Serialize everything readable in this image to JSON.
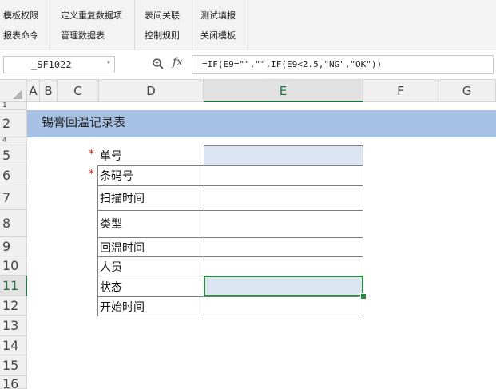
{
  "ribbon": {
    "groups": [
      {
        "top": "模板权限",
        "bottom": "报表命令"
      },
      {
        "top": "定义重复数据项",
        "bottom": "管理数据表"
      },
      {
        "top": "表间关联",
        "bottom": "控制规则"
      },
      {
        "top": "测试填报",
        "bottom": "关闭模板"
      }
    ]
  },
  "formula_bar": {
    "name_box": "_SF1022",
    "formula": "=IF(E9=\"\",\"\",IF(E9<2.5,\"NG\",\"OK\"))",
    "fx_label": "fx"
  },
  "columns": [
    "A",
    "B",
    "C",
    "D",
    "E",
    "F",
    "G"
  ],
  "rows": [
    "1",
    "2",
    "4",
    "5",
    "6",
    "7",
    "8",
    "9",
    "10",
    "11",
    "12",
    "13",
    "14",
    "15",
    "16"
  ],
  "sheet": {
    "title": "锡膏回温记录表",
    "fields": [
      {
        "label": "单号",
        "required": "*"
      },
      {
        "label": "条码号",
        "required": "*"
      },
      {
        "label": "扫描时间"
      },
      {
        "label": "类型"
      },
      {
        "label": "回温时间"
      },
      {
        "label": "人员"
      },
      {
        "label": "状态"
      },
      {
        "label": "开始时间"
      }
    ]
  },
  "colors": {
    "accent": "#217346",
    "title_band": "#a7c1e4",
    "input_fill": "#dce6f2"
  }
}
